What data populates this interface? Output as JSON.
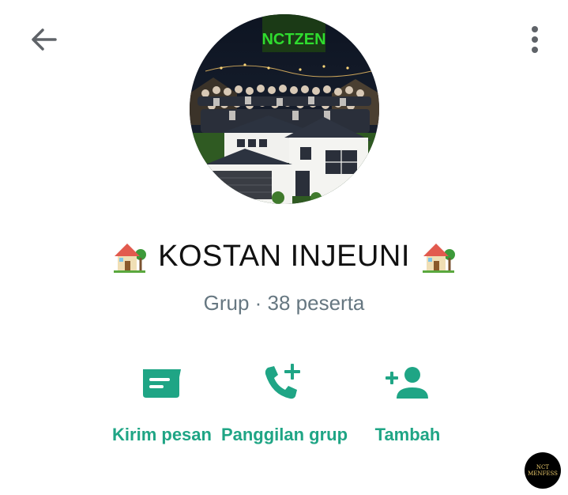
{
  "header": {
    "back_icon": "arrow-left-icon",
    "menu_icon": "more-vertical-icon"
  },
  "avatar": {
    "logo_text": "NCTZEN"
  },
  "group": {
    "name": "KOSTAN INJEUNI",
    "emoji_icon": "house-with-garden-icon",
    "subtitle": "Grup · 38 peserta"
  },
  "actions": [
    {
      "icon": "message-icon",
      "label": "Kirim pesan"
    },
    {
      "icon": "call-add-icon",
      "label": "Panggilan grup"
    },
    {
      "icon": "add-person-icon",
      "label": "Tambah"
    }
  ],
  "watermark": {
    "line1": "NCT",
    "line2": "MENFESS"
  },
  "colors": {
    "accent": "#1fa585",
    "subtitle": "#667781",
    "icon_gray": "#5f6368"
  }
}
